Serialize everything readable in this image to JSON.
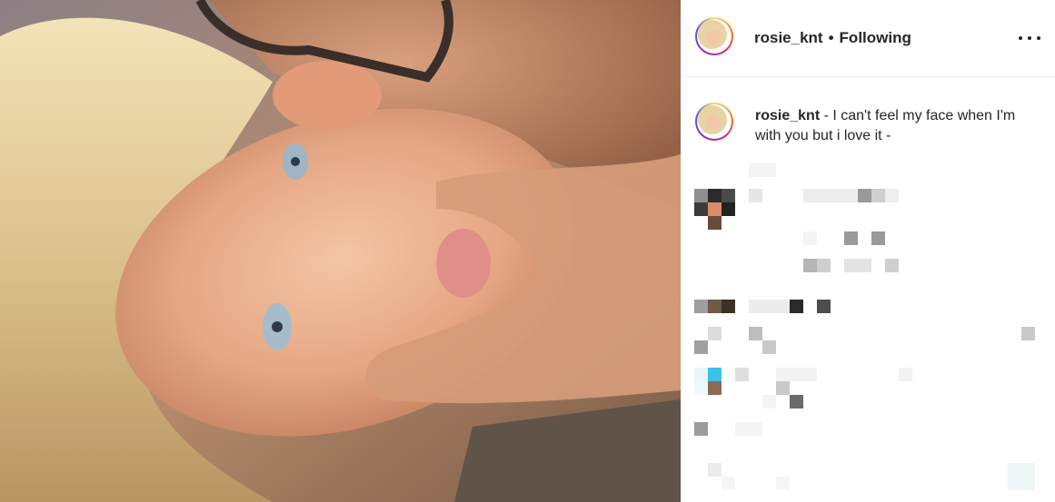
{
  "photo": {
    "alt_icon": "photo-image"
  },
  "post_header": {
    "username": "rosie_knt",
    "separator": "•",
    "follow_state": "Following",
    "more_icon": "more-horizontal-icon"
  },
  "caption": {
    "username": "rosie_knt",
    "text": " - I can't feel my face when I'm with you but i love it -"
  },
  "colors": {
    "text": "#262626",
    "divider": "#efefef",
    "ring_gradient": [
      "#feda75",
      "#fa7e1e",
      "#d62976",
      "#962fbf",
      "#4f5bd5"
    ]
  }
}
